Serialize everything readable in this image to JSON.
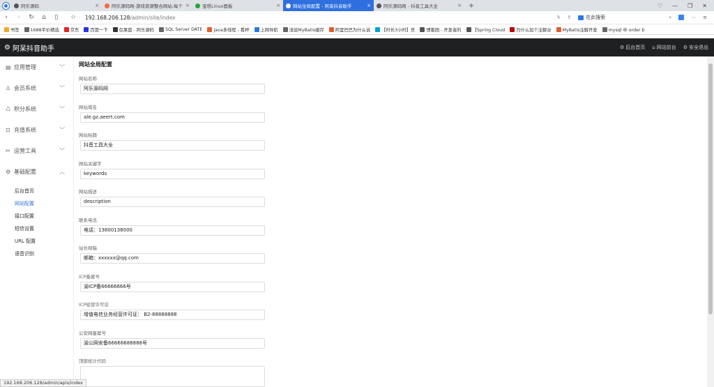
{
  "browser": {
    "tabs": [
      {
        "title": "阿乐源码",
        "color": "#555555",
        "active": false
      },
      {
        "title": "阿乐源码网-游戏资源整合网站,每个",
        "color": "#f26b3a",
        "active": false
      },
      {
        "title": "宝塔Linux面板",
        "color": "#20a53a",
        "active": false
      },
      {
        "title": "网站全局配置 - 阿呆抖音助手",
        "color": "#ffffff",
        "active": true
      },
      {
        "title": "阿乐源码网 - 抖音工具大全",
        "color": "#555555",
        "active": false
      }
    ],
    "tab_close": "×",
    "new_tab": "+",
    "window_controls": [
      "♡",
      "—",
      "❐",
      "✕"
    ],
    "url_host": "192.168.206.128",
    "url_path": "/admin/site/index",
    "search_placeholder": "在此搜索",
    "bookmarks": [
      {
        "label": "书签",
        "color": "#f5a623"
      },
      {
        "label": "1688平价精选",
        "color": "#666666"
      },
      {
        "label": "京东",
        "color": "#e1251b"
      },
      {
        "label": "百度一下",
        "color": "#2932e1"
      },
      {
        "label": "仅果盘 - 阿乐源码",
        "color": "#333333"
      },
      {
        "label": "SQL Server DATE",
        "color": "#666666"
      },
      {
        "label": "Java多线程 - 看杯",
        "color": "#e05d2e"
      },
      {
        "label": "上网导航",
        "color": "#2a7ae2"
      },
      {
        "label": "浅谈MyBatis缓存",
        "color": "#666666"
      },
      {
        "label": "阿里巴巴为什么说",
        "color": "#e05d2e"
      },
      {
        "label": "【时长3小时】世",
        "color": "#00a1d6"
      },
      {
        "label": "博客园 - 开发者的",
        "color": "#555555"
      },
      {
        "label": "【Spring Cloud",
        "color": "#555555"
      },
      {
        "label": "为什么加个注解@",
        "color": "#c00000"
      },
      {
        "label": "MyBatis注解开发",
        "color": "#e05d2e"
      },
      {
        "label": "mysql 中 order b",
        "color": "#666666"
      }
    ]
  },
  "app": {
    "brand": "阿呆抖音助手",
    "header_links": [
      "后台首页",
      "网站前台",
      "安全退出"
    ]
  },
  "sidebar": {
    "groups": [
      {
        "label": "应用管理",
        "icon": "app-icon",
        "glyph": "▤",
        "expanded": false
      },
      {
        "label": "会员系统",
        "icon": "user-icon",
        "glyph": "♙",
        "expanded": false
      },
      {
        "label": "积分系统",
        "icon": "points-icon",
        "glyph": "♺",
        "expanded": false
      },
      {
        "label": "充值系统",
        "icon": "recharge-icon",
        "glyph": "⊡",
        "expanded": false
      },
      {
        "label": "运营工具",
        "icon": "tools-icon",
        "glyph": "✂",
        "expanded": false
      },
      {
        "label": "基础配置",
        "icon": "config-icon",
        "glyph": "⚙",
        "expanded": true
      }
    ],
    "subitems": [
      {
        "label": "后台首页",
        "active": false
      },
      {
        "label": "网站配置",
        "active": true
      },
      {
        "label": "接口配置",
        "active": false
      },
      {
        "label": "短信设置",
        "active": false
      },
      {
        "label": "URL 配置",
        "active": false
      },
      {
        "label": "语音识别",
        "active": false
      }
    ]
  },
  "form": {
    "title": "网站全局配置",
    "fields": [
      {
        "label": "网站名称",
        "value": "阿乐源码网"
      },
      {
        "label": "网站域名",
        "value": "ale.gz.aeert.com"
      },
      {
        "label": "网站标题",
        "value": "抖音工具大全"
      },
      {
        "label": "网站关键字",
        "value": "keywords"
      },
      {
        "label": "网站描述",
        "value": "description"
      },
      {
        "label": "联系电话",
        "value": "电话：13800138000"
      },
      {
        "label": "站长邮箱",
        "value": "邮箱：xxxxxx@qq.com"
      },
      {
        "label": "ICP备案号",
        "value": "渝ICP备66666666号"
      },
      {
        "label": "ICP经营许可证",
        "value": "增值电信业务经营许可证： B2-88888888"
      },
      {
        "label": "公安网备案号",
        "value": "渝公网安备66666688888号"
      }
    ],
    "textarea_label": "顶部统计代码"
  },
  "status_url": "192.168.206.128/admin/apis/index"
}
